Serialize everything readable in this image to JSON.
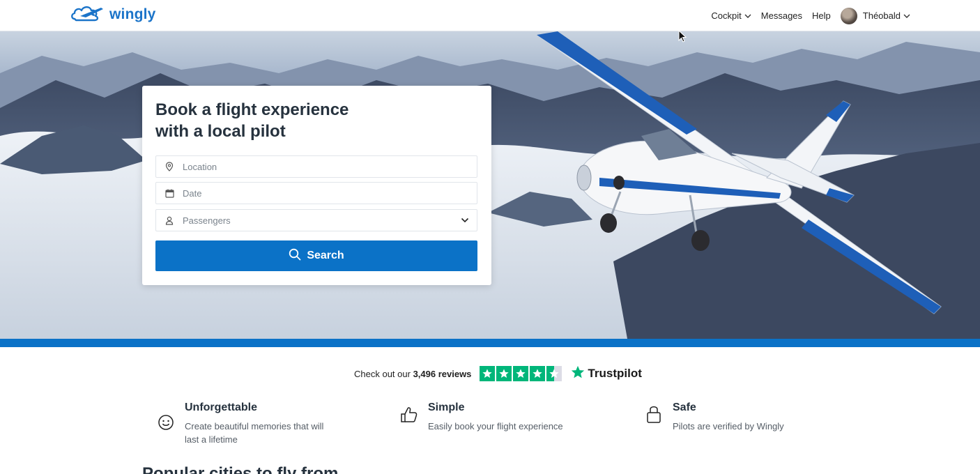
{
  "header": {
    "brand": "wingly",
    "nav": [
      {
        "label": "Cockpit",
        "has_dropdown": true
      },
      {
        "label": "Messages",
        "has_dropdown": false
      },
      {
        "label": "Help",
        "has_dropdown": false
      }
    ],
    "user": {
      "name": "Théobald",
      "has_dropdown": true
    }
  },
  "booking": {
    "title_line1": "Book a flight experience",
    "title_line2": "with a local pilot",
    "fields": {
      "location": {
        "placeholder": "Location",
        "icon": "location-pin-icon"
      },
      "date": {
        "placeholder": "Date",
        "icon": "calendar-icon"
      },
      "passengers": {
        "placeholder": "Passengers",
        "icon": "person-icon"
      }
    },
    "search_label": "Search"
  },
  "reviews": {
    "prefix": "Check out our",
    "count": "3,496 reviews",
    "rating_stars": 4.5,
    "provider": "Trustpilot"
  },
  "features": [
    {
      "title": "Unforgettable",
      "desc": "Create beautiful memories that will last a lifetime",
      "icon": "smiley-icon"
    },
    {
      "title": "Simple",
      "desc": "Easily book your flight experience",
      "icon": "thumbs-up-icon"
    },
    {
      "title": "Safe",
      "desc": "Pilots are verified by Wingly",
      "icon": "lock-icon"
    }
  ],
  "popular_heading": "Popular cities to fly from",
  "colors": {
    "brand_blue": "#0b72c7",
    "trustpilot_green": "#00b67a",
    "text_dark": "#26323e"
  }
}
